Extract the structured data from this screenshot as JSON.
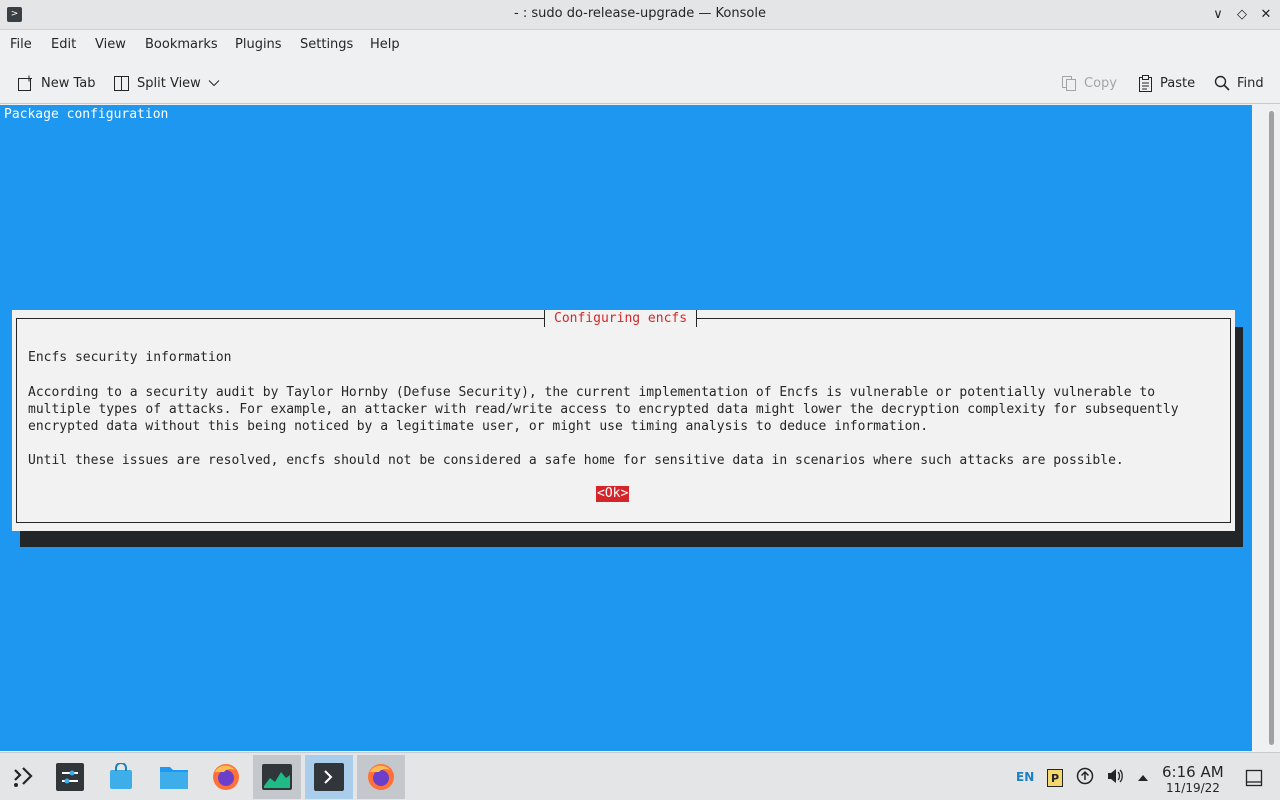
{
  "window": {
    "title": "- : sudo do-release-upgrade — Konsole",
    "minimize_glyph": "∨",
    "maximize_glyph": "◇",
    "close_glyph": "✕"
  },
  "menubar": {
    "items": [
      "File",
      "Edit",
      "View",
      "Bookmarks",
      "Plugins",
      "Settings",
      "Help"
    ]
  },
  "toolbar": {
    "new_tab": "New Tab",
    "split_view": "Split View",
    "copy": "Copy",
    "paste": "Paste",
    "find": "Find"
  },
  "terminal": {
    "screen_title": "Package configuration",
    "background": "#1e97f0",
    "dialog": {
      "title": "Configuring encfs",
      "heading": "Encfs security information",
      "paragraph1": [
        "According to a security audit by Taylor Hornby (Defuse Security), the current implementation of Encfs is vulnerable or potentially vulnerable to",
        "multiple types of attacks. For example, an attacker with read/write access to encrypted data might lower the decryption complexity for subsequently",
        "encrypted data without this being noticed by a legitimate user, or might use timing analysis to deduce information."
      ],
      "paragraph2": "Until these issues are resolved, encfs should not be considered a safe home for sensitive data in scenarios where such attacks are possible.",
      "ok_button": "<Ok>"
    }
  },
  "taskbar": {
    "apps": [
      {
        "name": "application-launcher-icon"
      },
      {
        "name": "system-settings-icon"
      },
      {
        "name": "discover-store-icon"
      },
      {
        "name": "dolphin-files-icon"
      },
      {
        "name": "firefox-icon"
      },
      {
        "name": "system-monitor-icon",
        "state": "active"
      },
      {
        "name": "konsole-icon",
        "state": "focused"
      },
      {
        "name": "firefox-window-icon",
        "state": "active"
      }
    ],
    "tray": {
      "keyboard_layout": "EN"
    },
    "clock": {
      "time": "6:16 AM",
      "date": "11/19/22"
    }
  }
}
